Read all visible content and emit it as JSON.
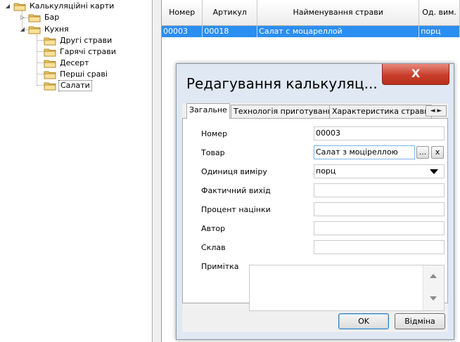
{
  "tree": {
    "root": "Калькуляційні карти",
    "items": [
      {
        "label": "Бар"
      },
      {
        "label": "Кухня"
      }
    ],
    "kitchen_children": [
      {
        "label": "Другі страви"
      },
      {
        "label": "Гарячі страви"
      },
      {
        "label": "Десерт"
      },
      {
        "label": "Перші сраві"
      },
      {
        "label": "Салати"
      }
    ]
  },
  "grid": {
    "columns": [
      "Номер",
      "Артикул",
      "Найменування страви",
      "Од. вим."
    ],
    "rows": [
      {
        "number": "00003",
        "article": "00018",
        "name": "Салат с моцареллой",
        "unit": "порц"
      }
    ]
  },
  "dialog": {
    "title": "Редагування калькуляц...",
    "close_glyph": "X",
    "tabs": [
      "Загальне",
      "Технологія приготування",
      "Характеристика страви"
    ],
    "tab_scroll": "◄ ►",
    "fields": {
      "number": {
        "label": "Номер",
        "value": "00003"
      },
      "product": {
        "label": "Товар",
        "value": "Салат з моціреллою",
        "browse": "...",
        "clear": "x"
      },
      "unit": {
        "label": "Одиниця виміру",
        "value": "порц"
      },
      "actual_output": {
        "label": "Фактичний вихід",
        "value": ""
      },
      "markup_percent": {
        "label": "Процент націнки",
        "value": ""
      },
      "author": {
        "label": "Автор",
        "value": ""
      },
      "composition": {
        "label": "Склав",
        "value": ""
      },
      "note": {
        "label": "Примітка",
        "value": ""
      }
    },
    "ok_label": "OK",
    "cancel_label": "Відміна"
  }
}
